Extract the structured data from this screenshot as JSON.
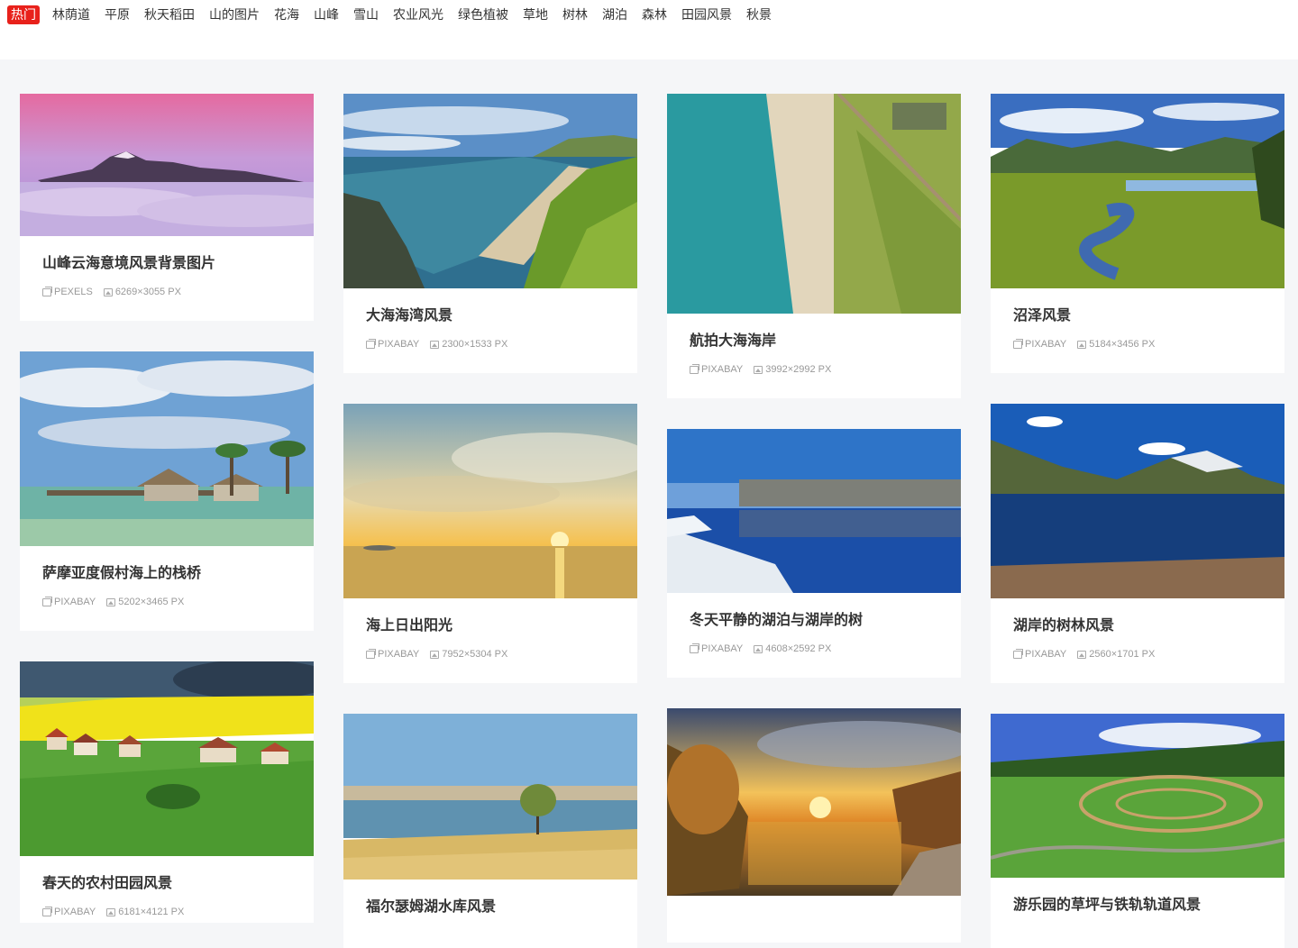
{
  "nav": {
    "tags": [
      "热门",
      "林荫道",
      "平原",
      "秋天稻田",
      "山的图片",
      "花海",
      "山峰",
      "雪山",
      "农业风光",
      "绿色植被",
      "草地",
      "树林",
      "湖泊",
      "森林",
      "田园风景",
      "秋景"
    ]
  },
  "cards": [
    {
      "title": "山峰云海意境风景背景图片",
      "source": "PEXELS",
      "size": "6269×3055 PX"
    },
    {
      "title": "大海海湾风景",
      "source": "PIXABAY",
      "size": "2300×1533 PX"
    },
    {
      "title": "航拍大海海岸",
      "source": "PIXABAY",
      "size": "3992×2992 PX"
    },
    {
      "title": "沼泽风景",
      "source": "PIXABAY",
      "size": "5184×3456 PX"
    },
    {
      "title": "萨摩亚度假村海上的栈桥",
      "source": "PIXABAY",
      "size": "5202×3465 PX"
    },
    {
      "title": "海上日出阳光",
      "source": "PIXABAY",
      "size": "7952×5304 PX"
    },
    {
      "title": "冬天平静的湖泊与湖岸的树",
      "source": "PIXABAY",
      "size": "4608×2592 PX"
    },
    {
      "title": "湖岸的树林风景",
      "source": "PIXABAY",
      "size": "2560×1701 PX"
    },
    {
      "title": "春天的农村田园风景",
      "source": "PIXABAY",
      "size": "6181×4121 PX"
    },
    {
      "title": "福尔瑟姆湖水库风景",
      "source": "",
      "size": ""
    },
    {
      "title": "",
      "source": "",
      "size": ""
    },
    {
      "title": "游乐园的草坪与铁轨轨道风景",
      "source": "",
      "size": ""
    }
  ]
}
